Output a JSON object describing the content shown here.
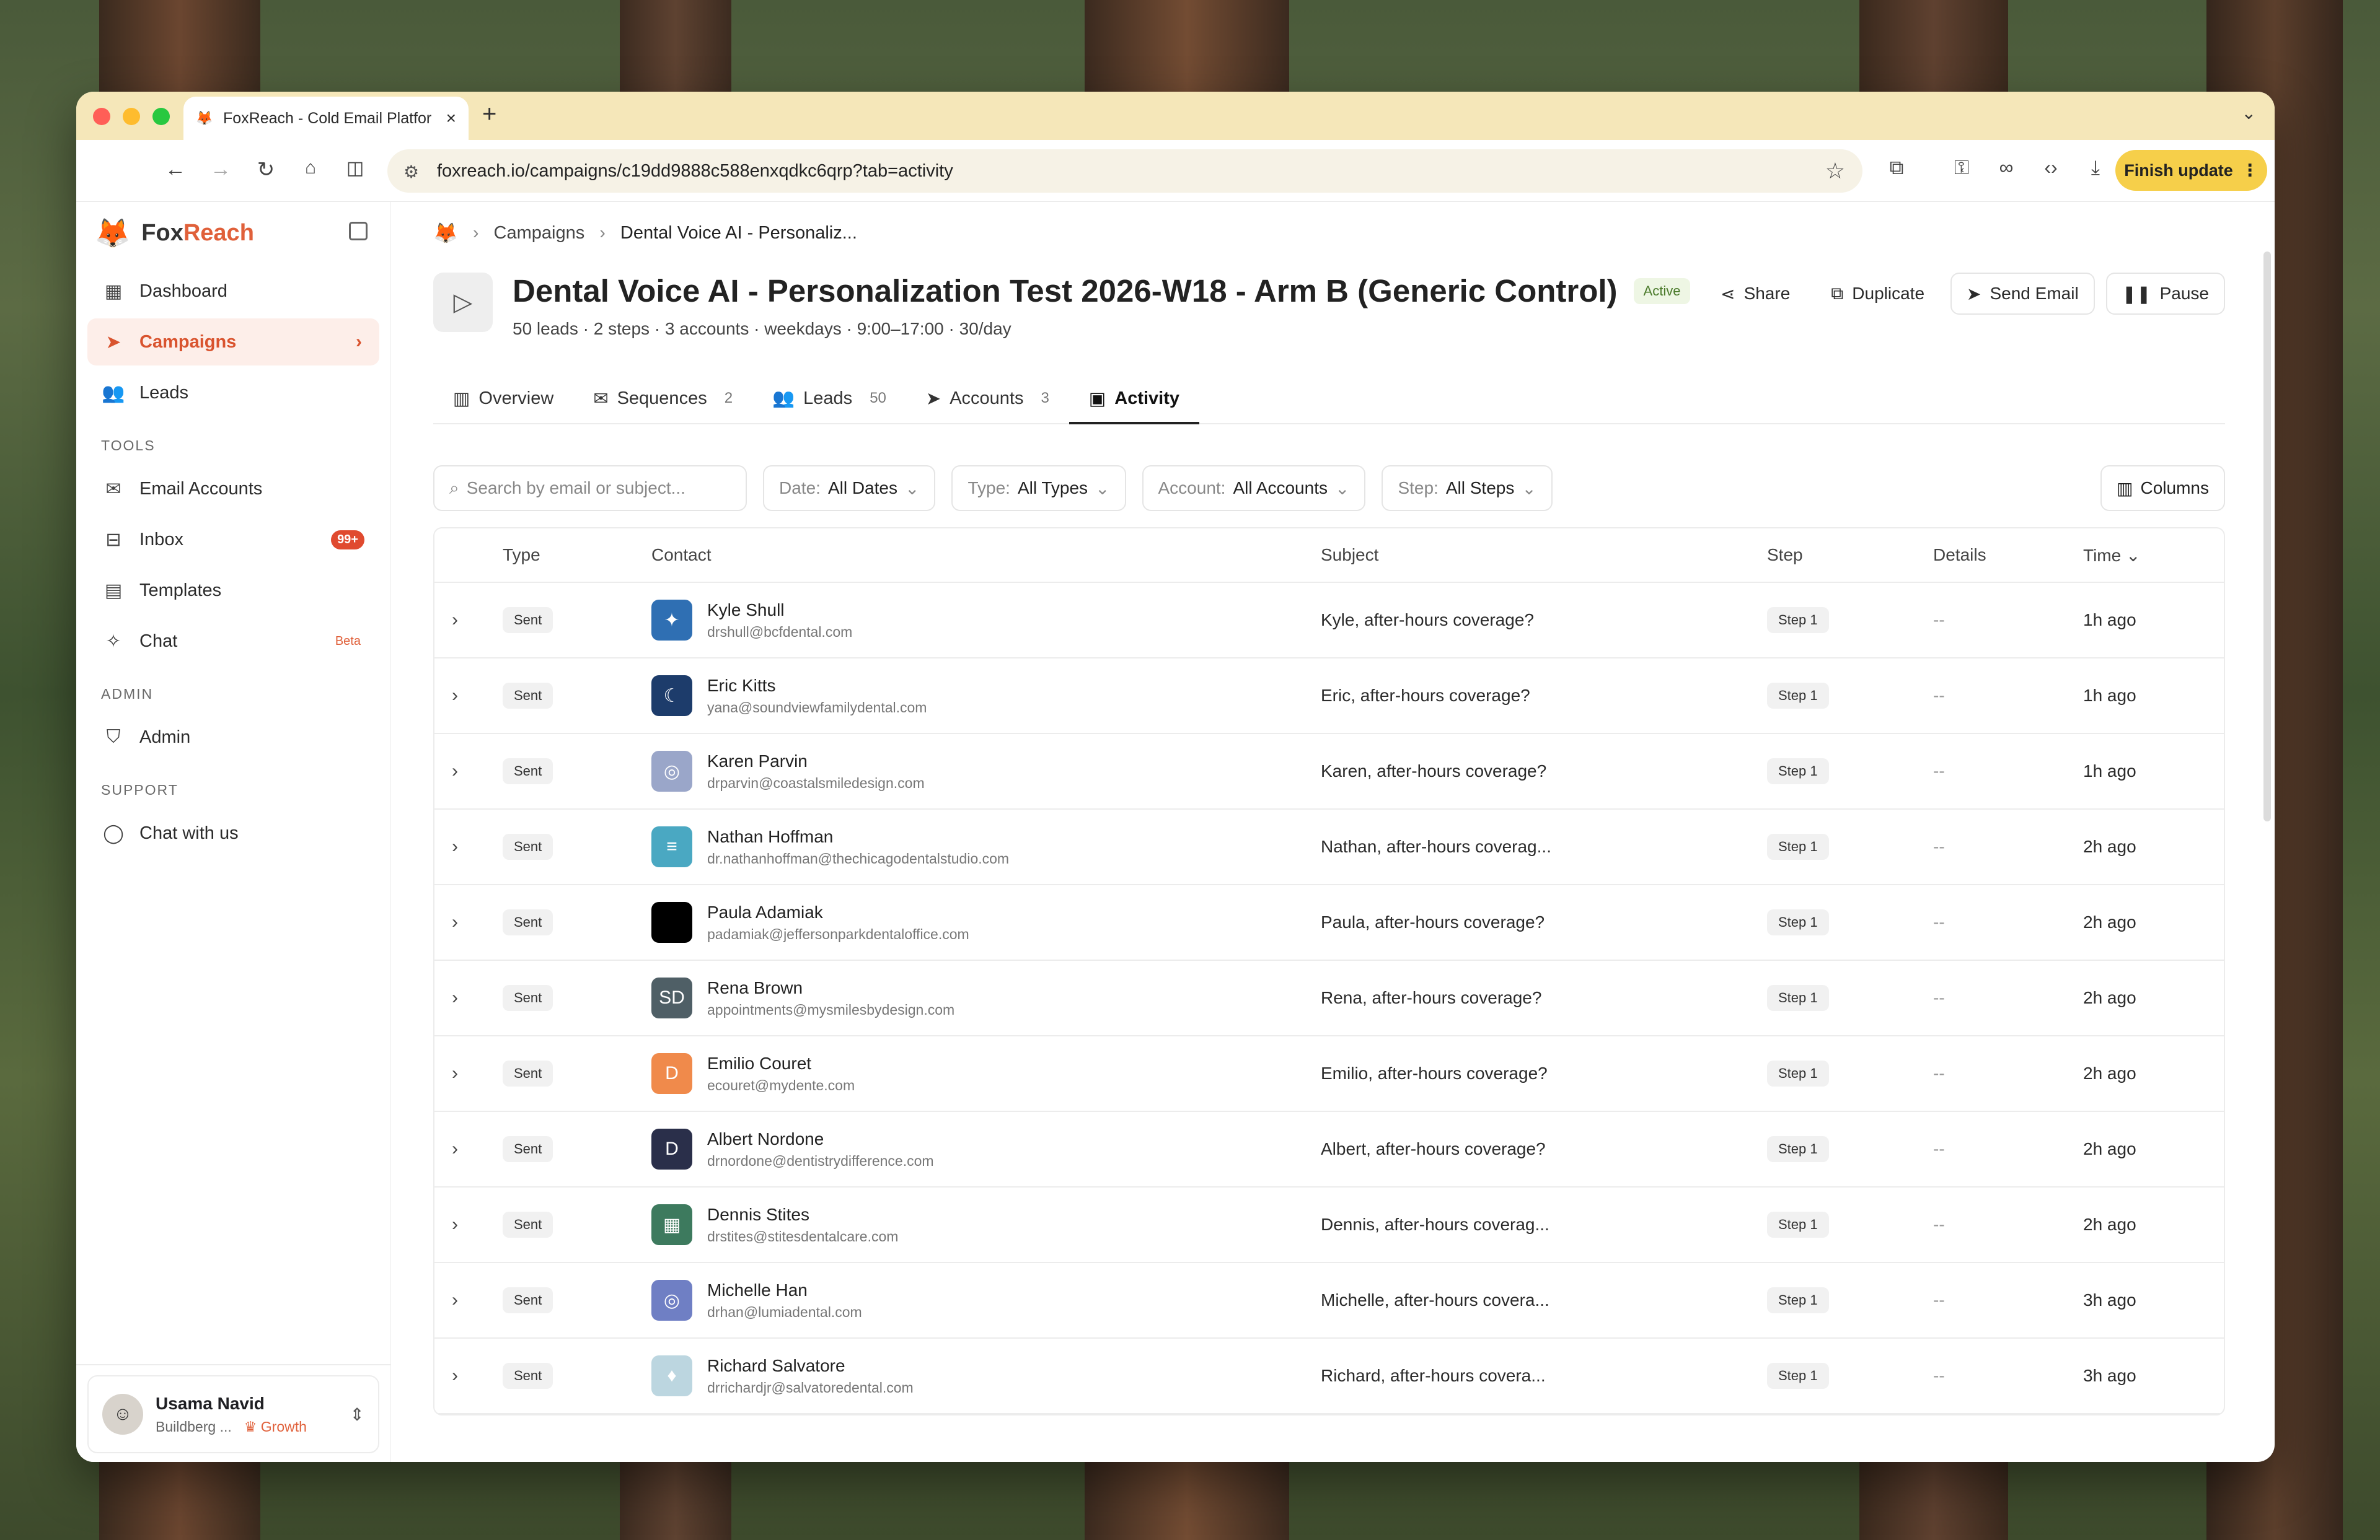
{
  "browser": {
    "tab_title": "FoxReach - Cold Email Platfor",
    "url": "foxreach.io/campaigns/c19dd9888c588enxqdkc6qrp?tab=activity",
    "finish_update": "Finish update"
  },
  "sidebar": {
    "brand_a": "Fox",
    "brand_b": "Reach",
    "nav": [
      {
        "label": "Dashboard",
        "icon": "dashboard-icon"
      },
      {
        "label": "Campaigns",
        "icon": "send-icon"
      },
      {
        "label": "Leads",
        "icon": "users-icon"
      }
    ],
    "tools_title": "TOOLS",
    "tools": [
      {
        "label": "Email Accounts",
        "icon": "mail-icon"
      },
      {
        "label": "Inbox",
        "icon": "inbox-icon",
        "badge": "99+"
      },
      {
        "label": "Templates",
        "icon": "file-icon"
      },
      {
        "label": "Chat",
        "icon": "sparkles-icon",
        "tag": "Beta"
      }
    ],
    "admin_title": "ADMIN",
    "admin": [
      {
        "label": "Admin",
        "icon": "shield-icon"
      }
    ],
    "support_title": "SUPPORT",
    "support": [
      {
        "label": "Chat with us",
        "icon": "chat-icon"
      }
    ],
    "user": {
      "name": "Usama Navid",
      "org": "Buildberg ...",
      "plan": "Growth"
    }
  },
  "breadcrumb": {
    "parent": "Campaigns",
    "current": "Dental Voice AI - Personaliz..."
  },
  "campaign": {
    "title": "Dental Voice AI - Personalization Test 2026-W18 - Arm B (Generic Control)",
    "status": "Active",
    "meta": "50 leads · 2 steps · 3 accounts · weekdays · 9:00–17:00 · 30/day",
    "actions": {
      "share": "Share",
      "duplicate": "Duplicate",
      "send": "Send Email",
      "pause": "Pause"
    }
  },
  "tabs": [
    {
      "label": "Overview",
      "count": ""
    },
    {
      "label": "Sequences",
      "count": "2"
    },
    {
      "label": "Leads",
      "count": "50"
    },
    {
      "label": "Accounts",
      "count": "3"
    },
    {
      "label": "Activity",
      "count": ""
    }
  ],
  "filters": {
    "search_placeholder": "Search by email or subject...",
    "date_label": "Date:",
    "date_value": "All Dates",
    "type_label": "Type:",
    "type_value": "All Types",
    "account_label": "Account:",
    "account_value": "All Accounts",
    "step_label": "Step:",
    "step_value": "All Steps",
    "columns": "Columns"
  },
  "table": {
    "headers": {
      "type": "Type",
      "contact": "Contact",
      "subject": "Subject",
      "step": "Step",
      "details": "Details",
      "time": "Time"
    },
    "rows": [
      {
        "type": "Sent",
        "name": "Kyle Shull",
        "email": "drshull@bcfdental.com",
        "subject": "Kyle, after-hours coverage?",
        "step": "Step 1",
        "details": "--",
        "time": "1h ago",
        "avatar_color": "#2f6fb3",
        "avatar_text": "✦"
      },
      {
        "type": "Sent",
        "name": "Eric Kitts",
        "email": "yana@soundviewfamilydental.com",
        "subject": "Eric, after-hours coverage?",
        "step": "Step 1",
        "details": "--",
        "time": "1h ago",
        "avatar_color": "#1d3c6b",
        "avatar_text": "☾"
      },
      {
        "type": "Sent",
        "name": "Karen Parvin",
        "email": "drparvin@coastalsmiledesign.com",
        "subject": "Karen, after-hours coverage?",
        "step": "Step 1",
        "details": "--",
        "time": "1h ago",
        "avatar_color": "#9aa6c9",
        "avatar_text": "◎"
      },
      {
        "type": "Sent",
        "name": "Nathan Hoffman",
        "email": "dr.nathanhoffman@thechicagodentalstudio.com",
        "subject": "Nathan, after-hours coverag...",
        "step": "Step 1",
        "details": "--",
        "time": "2h ago",
        "avatar_color": "#4aa8c2",
        "avatar_text": "≡"
      },
      {
        "type": "Sent",
        "name": "Paula Adamiak",
        "email": "padamiak@jeffersonparkdentaloffice.com",
        "subject": "Paula, after-hours coverage?",
        "step": "Step 1",
        "details": "--",
        "time": "2h ago",
        "avatar_color": "#000000",
        "avatar_text": ""
      },
      {
        "type": "Sent",
        "name": "Rena Brown",
        "email": "appointments@mysmilesbydesign.com",
        "subject": "Rena, after-hours coverage?",
        "step": "Step 1",
        "details": "--",
        "time": "2h ago",
        "avatar_color": "#4f5f66",
        "avatar_text": "SD"
      },
      {
        "type": "Sent",
        "name": "Emilio Couret",
        "email": "ecouret@mydente.com",
        "subject": "Emilio, after-hours coverage?",
        "step": "Step 1",
        "details": "--",
        "time": "2h ago",
        "avatar_color": "#f08a4b",
        "avatar_text": "D"
      },
      {
        "type": "Sent",
        "name": "Albert Nordone",
        "email": "drnordone@dentistrydifference.com",
        "subject": "Albert, after-hours coverage?",
        "step": "Step 1",
        "details": "--",
        "time": "2h ago",
        "avatar_color": "#2a2f4a",
        "avatar_text": "D"
      },
      {
        "type": "Sent",
        "name": "Dennis Stites",
        "email": "drstites@stitesdentalcare.com",
        "subject": "Dennis, after-hours coverag...",
        "step": "Step 1",
        "details": "--",
        "time": "2h ago",
        "avatar_color": "#3d7a5e",
        "avatar_text": "▦"
      },
      {
        "type": "Sent",
        "name": "Michelle Han",
        "email": "drhan@lumiadental.com",
        "subject": "Michelle, after-hours covera...",
        "step": "Step 1",
        "details": "--",
        "time": "3h ago",
        "avatar_color": "#6f7fc4",
        "avatar_text": "◎"
      },
      {
        "type": "Sent",
        "name": "Richard Salvatore",
        "email": "drrichardjr@salvatoredental.com",
        "subject": "Richard, after-hours covera...",
        "step": "Step 1",
        "details": "--",
        "time": "3h ago",
        "avatar_color": "#bcd6e0",
        "avatar_text": "♦"
      }
    ]
  }
}
